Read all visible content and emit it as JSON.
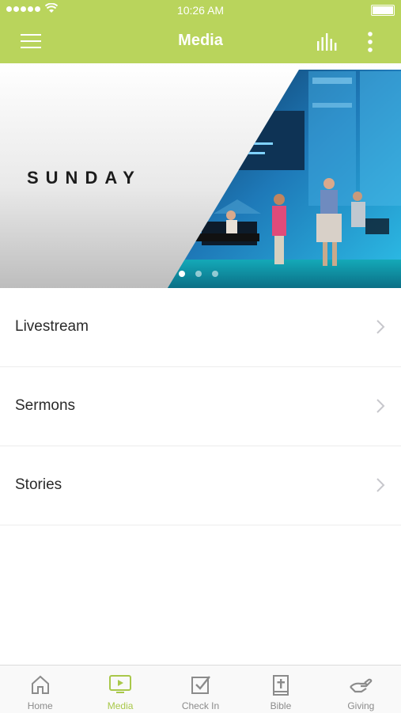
{
  "status_bar": {
    "time": "10:26 AM"
  },
  "header": {
    "title": "Media"
  },
  "hero": {
    "banner_text": "SUNDAY",
    "slide_count": 3,
    "active_slide": 1
  },
  "menu": {
    "items": [
      {
        "label": "Livestream"
      },
      {
        "label": "Sermons"
      },
      {
        "label": "Stories"
      }
    ]
  },
  "tabbar": {
    "tabs": [
      {
        "label": "Home",
        "icon": "home-icon"
      },
      {
        "label": "Media",
        "icon": "media-icon",
        "active": true
      },
      {
        "label": "Check In",
        "icon": "check-in-icon"
      },
      {
        "label": "Bible",
        "icon": "bible-icon"
      },
      {
        "label": "Giving",
        "icon": "giving-icon"
      }
    ]
  },
  "colors": {
    "accent": "#b9d45c",
    "active_tab": "#a9c84a",
    "inactive_tab": "#8b8b8b"
  }
}
